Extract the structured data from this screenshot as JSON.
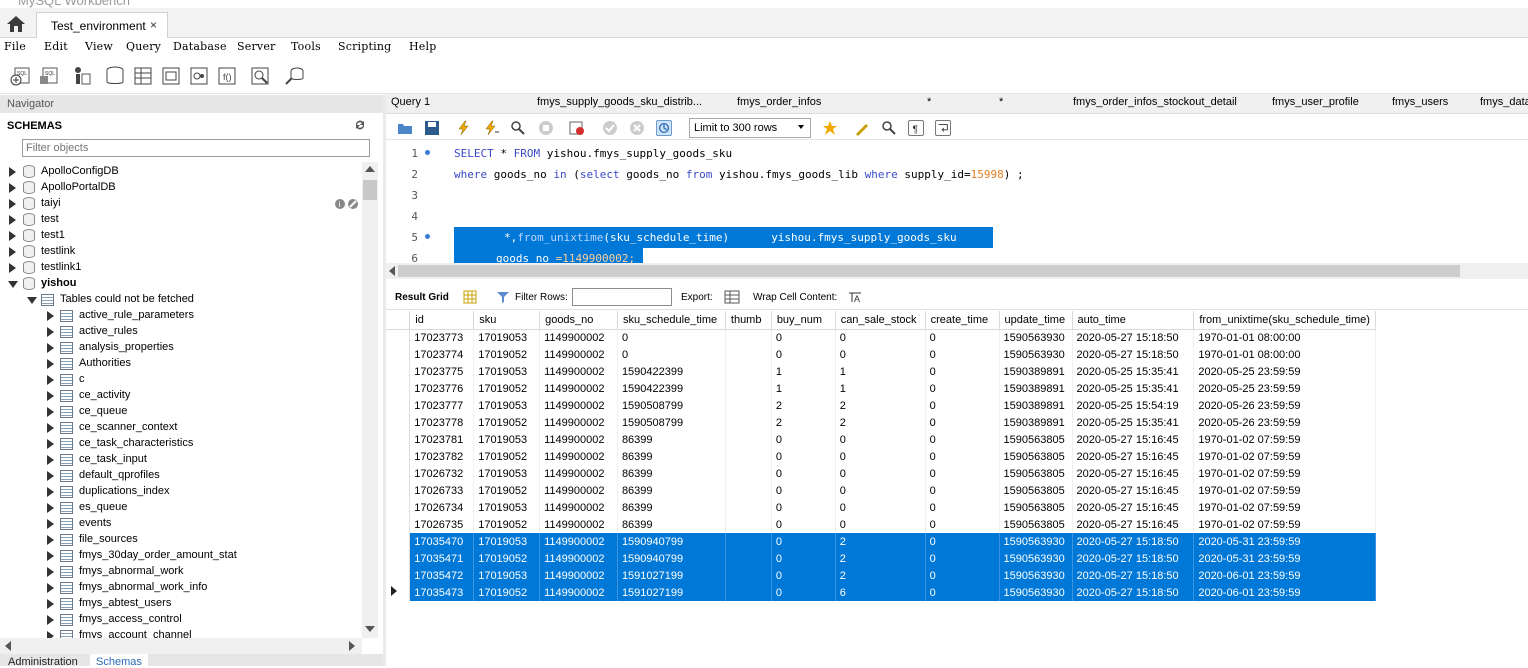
{
  "app": {
    "title": "MySQL Workbench"
  },
  "connection_tab": {
    "label": "Test_environment",
    "close": "×"
  },
  "menu": [
    "File",
    "Edit",
    "View",
    "Query",
    "Database",
    "Server",
    "Tools",
    "Scripting",
    "Help"
  ],
  "navigator": {
    "header": "Navigator",
    "schemas_label": "SCHEMAS",
    "filter_placeholder": "Filter objects",
    "schemas": [
      "ApolloConfigDB",
      "ApolloPortalDB",
      "taiyi",
      "test",
      "test1",
      "testlink",
      "testlink1"
    ],
    "open_schema": "yishou",
    "tables_folder": "Tables could not be fetched",
    "tables": [
      "active_rule_parameters",
      "active_rules",
      "analysis_properties",
      "Authorities",
      "c",
      "ce_activity",
      "ce_queue",
      "ce_scanner_context",
      "ce_task_characteristics",
      "ce_task_input",
      "default_qprofiles",
      "duplications_index",
      "es_queue",
      "events",
      "file_sources",
      "fmys_30day_order_amount_stat",
      "fmys_abnormal_work",
      "fmys_abnormal_work_info",
      "fmys_abtest_users",
      "fmys_access_control",
      "fmys_account_channel"
    ]
  },
  "bottom_tabs": [
    "Administration",
    "Schemas"
  ],
  "query_tabs": [
    "Query 1",
    "fmys_supply_goods_sku_distrib...",
    "fmys_order_infos",
    "*",
    "*",
    "fmys_order_infos_stockout_detail",
    "fmys_user_profile",
    "fmys_users",
    "fmys_data"
  ],
  "limit_label": "Limit to 300 rows",
  "editor": {
    "line_numbers": [
      "1",
      "2",
      "3",
      "4",
      "5",
      "6"
    ],
    "line1": {
      "kw1": "SELECT",
      "t1": " * ",
      "kw2": "FROM",
      "t2": " yishou.fmys_supply_goods_sku"
    },
    "line2": {
      "kw1": "where",
      "t1": " goods_no ",
      "kw2": "in",
      "t2": " (",
      "kw3": "select",
      "t3": " goods_no ",
      "kw4": "from",
      "t4": " yishou.fmys_goods_lib ",
      "kw5": "where",
      "t5": " supply_id=",
      "n1": "15998",
      "t6": ") ;"
    },
    "line5": {
      "a": "*,",
      "b": "from_unixtime",
      "c": "(sku_schedule_time)",
      "d": "yishou.fmys_supply_goods_sku"
    },
    "line6": {
      "a": "goods_no ",
      "b": "=1149900002;"
    }
  },
  "result_toolbar": {
    "result_grid": "Result Grid",
    "filter_rows": "Filter Rows:",
    "export": "Export:",
    "wrap": "Wrap Cell Content:"
  },
  "grid": {
    "columns": [
      "id",
      "sku",
      "goods_no",
      "sku_schedule_time",
      "thumb",
      "buy_num",
      "can_sale_stock",
      "create_time",
      "update_time",
      "auto_time",
      "from_unixtime(sku_schedule_time)"
    ],
    "rows": [
      [
        "17023773",
        "17019053",
        "1149900002",
        "0",
        "",
        "0",
        "0",
        "0",
        "1590563930",
        "2020-05-27 15:18:50",
        "1970-01-01 08:00:00"
      ],
      [
        "17023774",
        "17019052",
        "1149900002",
        "0",
        "",
        "0",
        "0",
        "0",
        "1590563930",
        "2020-05-27 15:18:50",
        "1970-01-01 08:00:00"
      ],
      [
        "17023775",
        "17019053",
        "1149900002",
        "1590422399",
        "",
        "1",
        "1",
        "0",
        "1590389891",
        "2020-05-25 15:35:41",
        "2020-05-25 23:59:59"
      ],
      [
        "17023776",
        "17019052",
        "1149900002",
        "1590422399",
        "",
        "1",
        "1",
        "0",
        "1590389891",
        "2020-05-25 15:35:41",
        "2020-05-25 23:59:59"
      ],
      [
        "17023777",
        "17019053",
        "1149900002",
        "1590508799",
        "",
        "2",
        "2",
        "0",
        "1590389891",
        "2020-05-25 15:54:19",
        "2020-05-26 23:59:59"
      ],
      [
        "17023778",
        "17019052",
        "1149900002",
        "1590508799",
        "",
        "2",
        "2",
        "0",
        "1590389891",
        "2020-05-25 15:35:41",
        "2020-05-26 23:59:59"
      ],
      [
        "17023781",
        "17019053",
        "1149900002",
        "86399",
        "",
        "0",
        "0",
        "0",
        "1590563805",
        "2020-05-27 15:16:45",
        "1970-01-02 07:59:59"
      ],
      [
        "17023782",
        "17019052",
        "1149900002",
        "86399",
        "",
        "0",
        "0",
        "0",
        "1590563805",
        "2020-05-27 15:16:45",
        "1970-01-02 07:59:59"
      ],
      [
        "17026732",
        "17019053",
        "1149900002",
        "86399",
        "",
        "0",
        "0",
        "0",
        "1590563805",
        "2020-05-27 15:16:45",
        "1970-01-02 07:59:59"
      ],
      [
        "17026733",
        "17019052",
        "1149900002",
        "86399",
        "",
        "0",
        "0",
        "0",
        "1590563805",
        "2020-05-27 15:16:45",
        "1970-01-02 07:59:59"
      ],
      [
        "17026734",
        "17019053",
        "1149900002",
        "86399",
        "",
        "0",
        "0",
        "0",
        "1590563805",
        "2020-05-27 15:16:45",
        "1970-01-02 07:59:59"
      ],
      [
        "17026735",
        "17019052",
        "1149900002",
        "86399",
        "",
        "0",
        "0",
        "0",
        "1590563805",
        "2020-05-27 15:16:45",
        "1970-01-02 07:59:59"
      ],
      [
        "17035470",
        "17019053",
        "1149900002",
        "1590940799",
        "",
        "0",
        "2",
        "0",
        "1590563930",
        "2020-05-27 15:18:50",
        "2020-05-31 23:59:59"
      ],
      [
        "17035471",
        "17019052",
        "1149900002",
        "1590940799",
        "",
        "0",
        "2",
        "0",
        "1590563930",
        "2020-05-27 15:18:50",
        "2020-05-31 23:59:59"
      ],
      [
        "17035472",
        "17019053",
        "1149900002",
        "1591027199",
        "",
        "0",
        "2",
        "0",
        "1590563930",
        "2020-05-27 15:18:50",
        "2020-06-01 23:59:59"
      ],
      [
        "17035473",
        "17019052",
        "1149900002",
        "1591027199",
        "",
        "0",
        "6",
        "0",
        "1590563930",
        "2020-05-27 15:18:50",
        "2020-06-01 23:59:59"
      ]
    ],
    "selected_rows": [
      12,
      13,
      14,
      15
    ],
    "current_row": 15
  },
  "colors": {
    "selection": "#0078d7",
    "keyword": "#3a49c8",
    "number": "#e67e22"
  }
}
